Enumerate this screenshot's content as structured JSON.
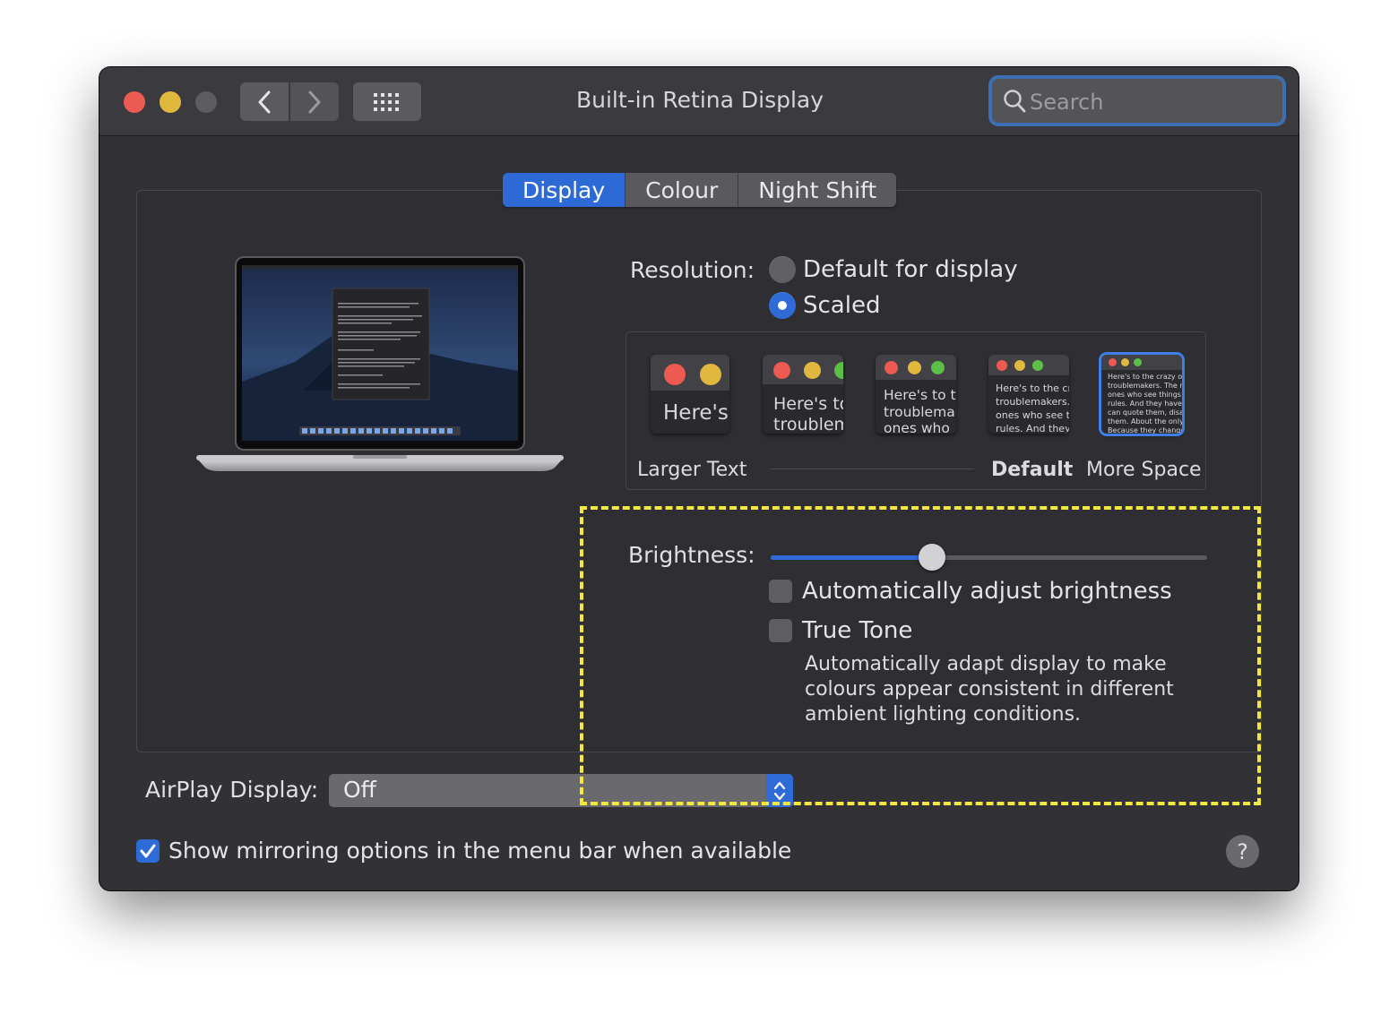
{
  "window": {
    "title": "Built-in Retina Display",
    "search_placeholder": "Search"
  },
  "tabs": [
    {
      "label": "Display",
      "active": true
    },
    {
      "label": "Colour",
      "active": false
    },
    {
      "label": "Night Shift",
      "active": false
    }
  ],
  "resolution": {
    "label": "Resolution:",
    "options": [
      {
        "label": "Default for display",
        "selected": false
      },
      {
        "label": "Scaled",
        "selected": true
      }
    ],
    "scales": [
      {
        "text": "Here's",
        "selected": false
      },
      {
        "text": "Here's to\ntroublem",
        "selected": false
      },
      {
        "text": "Here's to t\ntroublema\nones who",
        "selected": false
      },
      {
        "text": "Here's to the cr\ntroublemakers.\nones who see t\nrules. And they",
        "selected": false
      },
      {
        "text": "Here's to the crazy one\ntroublemakers. The rou\nones who see things dif\nrules. And they have no\ncan quote them, disagre\nthem. About the only th\nBecause they change th",
        "selected": true
      }
    ],
    "scale_labels": {
      "larger": "Larger Text",
      "default": "Default",
      "more": "More Space"
    }
  },
  "brightness": {
    "label": "Brightness:",
    "value": 0.37,
    "auto_label": "Automatically adjust brightness",
    "auto_checked": false,
    "true_tone_label": "True Tone",
    "true_tone_checked": false,
    "true_tone_desc": "Automatically adapt display to make colours appear consistent in different ambient lighting conditions."
  },
  "airplay": {
    "label": "AirPlay Display:",
    "value": "Off"
  },
  "mirroring": {
    "label": "Show mirroring options in the menu bar when available",
    "checked": true
  },
  "help_label": "?",
  "colors": {
    "accent": "#2f6bd7",
    "highlight": "#f4e83f",
    "close": "#ec5a51",
    "minimize": "#e1b83e"
  }
}
